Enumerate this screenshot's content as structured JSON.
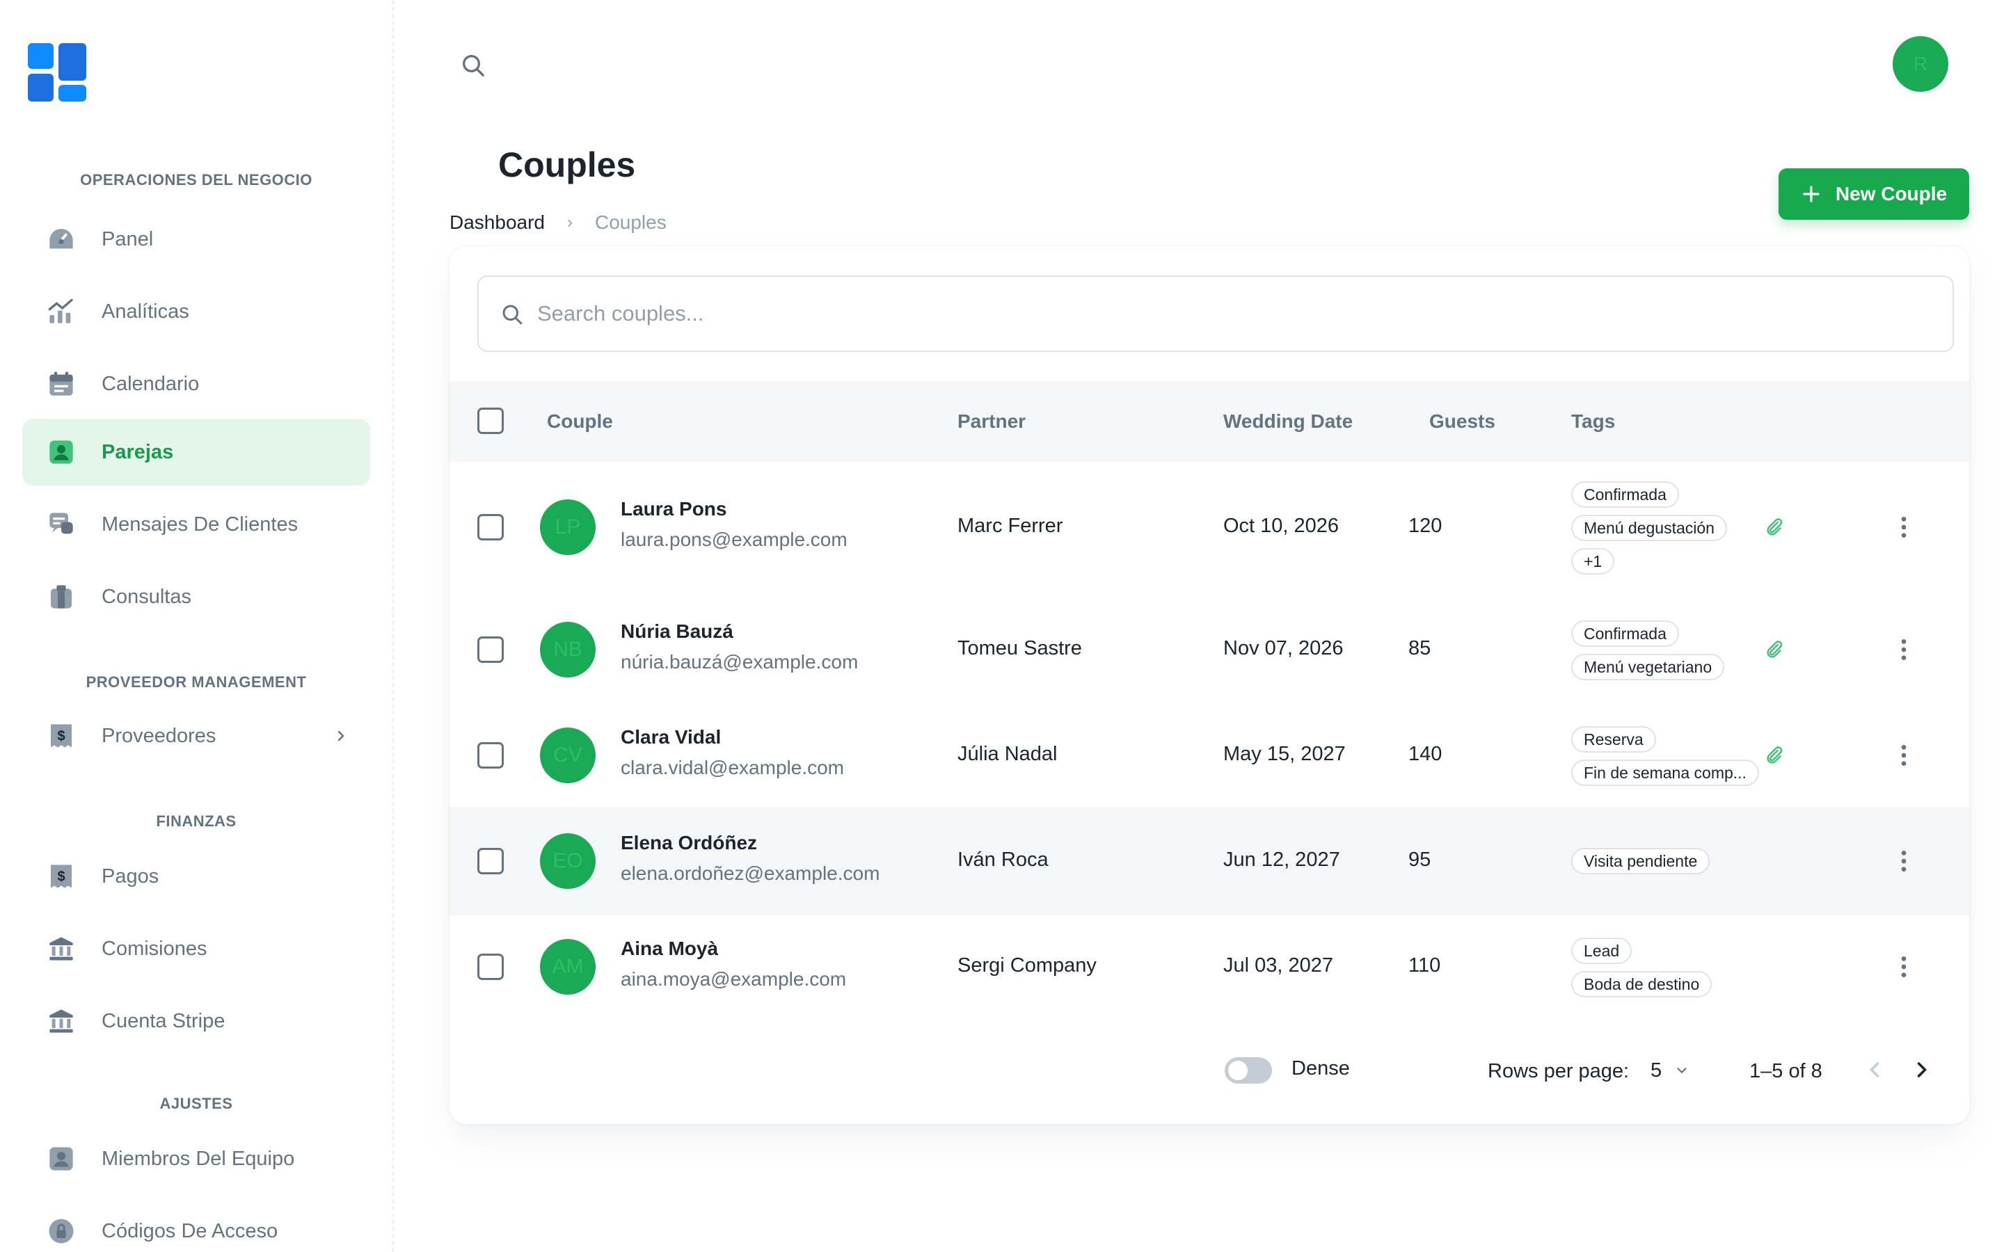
{
  "sidebar": {
    "sections": [
      {
        "title": "OPERACIONES DEL NEGOCIO"
      },
      {
        "title": "PROVEEDOR MANAGEMENT"
      },
      {
        "title": "FINANZAS"
      },
      {
        "title": "AJUSTES"
      }
    ],
    "items": [
      {
        "label": "Panel",
        "icon": "dashboard-icon"
      },
      {
        "label": "Analíticas",
        "icon": "analytics-icon"
      },
      {
        "label": "Calendario",
        "icon": "calendar-icon"
      },
      {
        "label": "Parejas",
        "icon": "user-icon",
        "active": true
      },
      {
        "label": "Mensajes De Clientes",
        "icon": "chat-icon"
      },
      {
        "label": "Consultas",
        "icon": "clipboard-icon"
      },
      {
        "label": "Proveedores",
        "icon": "invoice-icon"
      },
      {
        "label": "Pagos",
        "icon": "invoice-icon"
      },
      {
        "label": "Comisiones",
        "icon": "bank-icon"
      },
      {
        "label": "Cuenta Stripe",
        "icon": "bank-icon"
      },
      {
        "label": "Miembros Del Equipo",
        "icon": "user-icon"
      },
      {
        "label": "Códigos De Acceso",
        "icon": "lock-icon"
      }
    ]
  },
  "header": {
    "avatar_initial": "R"
  },
  "page": {
    "title": "Couples",
    "breadcrumb": {
      "home": "Dashboard",
      "separator": "›",
      "current": "Couples"
    },
    "new_button_label": "New Couple"
  },
  "search": {
    "placeholder": "Search couples..."
  },
  "table": {
    "columns": [
      "Couple",
      "Partner",
      "Wedding Date",
      "Guests",
      "Tags"
    ],
    "rows": [
      {
        "initials": "LP",
        "name": "Laura Pons",
        "email": "laura.pons@example.com",
        "partner": "Marc Ferrer",
        "date": "Oct 10, 2026",
        "guests": "120",
        "tags": [
          "Confirmada",
          "Menú degustación",
          "+1"
        ],
        "attachment": true
      },
      {
        "initials": "NB",
        "name": "Núria Bauzá",
        "email": "núria.bauzá@example.com",
        "partner": "Tomeu Sastre",
        "date": "Nov 07, 2026",
        "guests": "85",
        "tags": [
          "Confirmada",
          "Menú vegetariano"
        ],
        "attachment": true
      },
      {
        "initials": "CV",
        "name": "Clara Vidal",
        "email": "clara.vidal@example.com",
        "partner": "Júlia Nadal",
        "date": "May 15, 2027",
        "guests": "140",
        "tags": [
          "Reserva",
          "Fin de semana comp..."
        ],
        "attachment": true
      },
      {
        "initials": "EO",
        "name": "Elena Ordóñez",
        "email": "elena.ordoñez@example.com",
        "partner": "Iván Roca",
        "date": "Jun 12, 2027",
        "guests": "95",
        "tags": [
          "Visita pendiente"
        ],
        "attachment": false
      },
      {
        "initials": "AM",
        "name": "Aina Moyà",
        "email": "aina.moya@example.com",
        "partner": "Sergi Company",
        "date": "Jul 03, 2027",
        "guests": "110",
        "tags": [
          "Lead",
          "Boda de destino"
        ],
        "attachment": false
      }
    ]
  },
  "footer": {
    "dense_label": "Dense",
    "dense_enabled": false,
    "rows_per_page_label": "Rows per page:",
    "rows_per_page": "5",
    "range": "1–5 of 8"
  },
  "colors": {
    "accent": "#18a84d",
    "active_bg": "#e4f5ea",
    "active_text": "#1a9a4e",
    "muted": "#637381",
    "header_bg": "#f4f6f8"
  }
}
